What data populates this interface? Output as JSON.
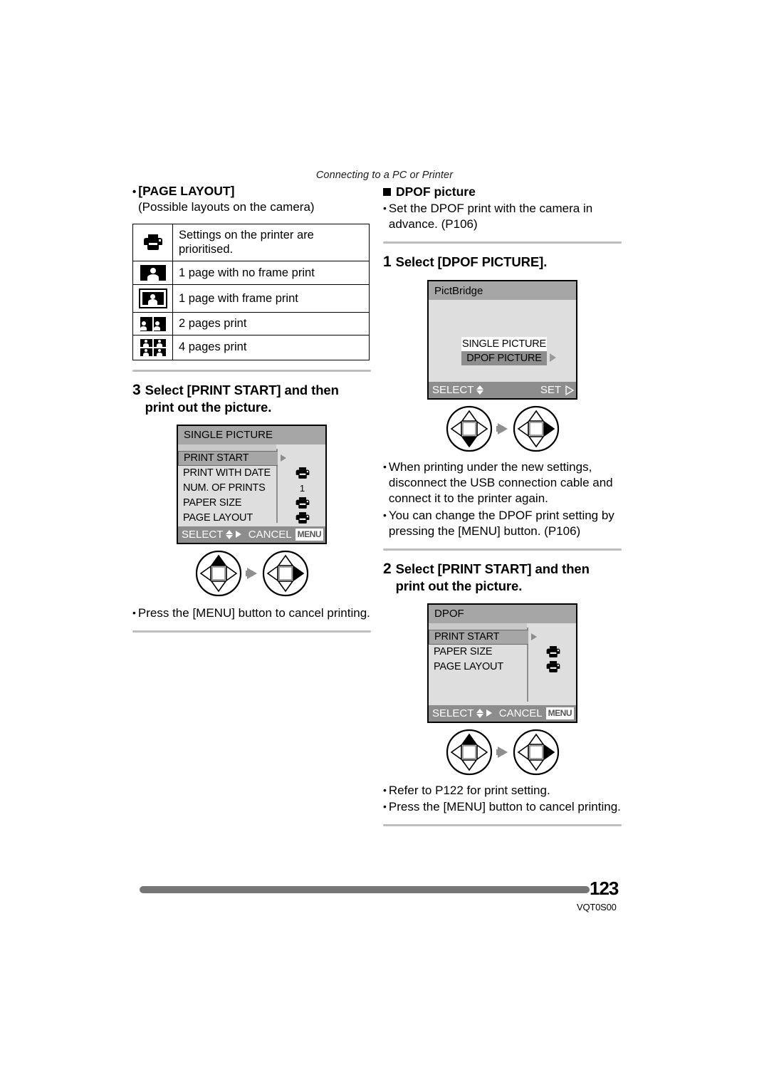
{
  "header": {
    "running_head": "Connecting to a PC or Printer"
  },
  "left_column": {
    "page_layout_section": {
      "bullet": "•",
      "title": "[PAGE LAYOUT]",
      "subtitle": "(Possible layouts on the camera)",
      "table": {
        "rows": [
          {
            "icon": "printer-icon",
            "description": "Settings on the printer are prioritised."
          },
          {
            "icon": "one-page-noframe-icon",
            "description": "1 page with no frame print"
          },
          {
            "icon": "one-page-frame-icon",
            "description": "1 page with frame print"
          },
          {
            "icon": "two-pages-icon",
            "description": "2 pages print"
          },
          {
            "icon": "four-pages-icon",
            "description": "4 pages print"
          }
        ]
      }
    },
    "step3": {
      "number": "3",
      "label": "Select [PRINT START] and then print out the picture."
    },
    "lcd_single_picture": {
      "title": "SINGLE PICTURE",
      "rows": [
        {
          "label": "PRINT START",
          "value": "",
          "selected": true,
          "arrow": true
        },
        {
          "label": "PRINT WITH DATE",
          "value": "printer-icon",
          "selected": false,
          "arrow": false
        },
        {
          "label": "NUM. OF PRINTS",
          "value": "1",
          "selected": false,
          "arrow": false
        },
        {
          "label": "PAPER SIZE",
          "value": "printer-icon",
          "selected": false,
          "arrow": false
        },
        {
          "label": "PAGE LAYOUT",
          "value": "printer-icon",
          "selected": false,
          "arrow": false
        }
      ],
      "footer_left": "SELECT",
      "footer_right": "CANCEL",
      "footer_menu_badge": "MENU"
    },
    "joystick": {
      "first_pressed": "up",
      "second_pressed": "right"
    },
    "note": {
      "bullet": "•",
      "text": "Press the [MENU] button to cancel printing."
    }
  },
  "right_column": {
    "dpof_section": {
      "title": "DPOF picture",
      "note": {
        "bullet": "•",
        "text": "Set the DPOF print with the camera in advance. (P106)"
      }
    },
    "step1": {
      "number": "1",
      "label": "Select [DPOF PICTURE]."
    },
    "lcd_pictbridge": {
      "title": "PictBridge",
      "items": [
        {
          "label": "SINGLE PICTURE",
          "selected": false
        },
        {
          "label": "DPOF PICTURE",
          "selected": true
        }
      ],
      "footer_left": "SELECT",
      "footer_right": "SET"
    },
    "joystick_1": {
      "first_pressed": "down",
      "second_pressed": "right"
    },
    "notes_1": [
      {
        "bullet": "•",
        "text": "When printing under the new settings, disconnect the USB connection cable and connect it to the printer again."
      },
      {
        "bullet": "•",
        "text": "You can change the DPOF print setting by pressing the [MENU] button. (P106)"
      }
    ],
    "step2": {
      "number": "2",
      "label": "Select [PRINT START] and then print out the picture."
    },
    "lcd_dpof": {
      "title": "DPOF",
      "rows": [
        {
          "label": "PRINT START",
          "value": "",
          "selected": true,
          "arrow": true
        },
        {
          "label": "PAPER SIZE",
          "value": "printer-icon",
          "selected": false,
          "arrow": false
        },
        {
          "label": "PAGE LAYOUT",
          "value": "printer-icon",
          "selected": false,
          "arrow": false
        }
      ],
      "footer_left": "SELECT",
      "footer_right": "CANCEL",
      "footer_menu_badge": "MENU"
    },
    "joystick_2": {
      "first_pressed": "up",
      "second_pressed": "right"
    },
    "notes_2": [
      {
        "bullet": "•",
        "text": "Refer to P122 for print setting."
      },
      {
        "bullet": "•",
        "text": "Press the [MENU] button to cancel printing."
      }
    ]
  },
  "footer": {
    "page_number": "123",
    "document_code": "VQT0S00"
  }
}
